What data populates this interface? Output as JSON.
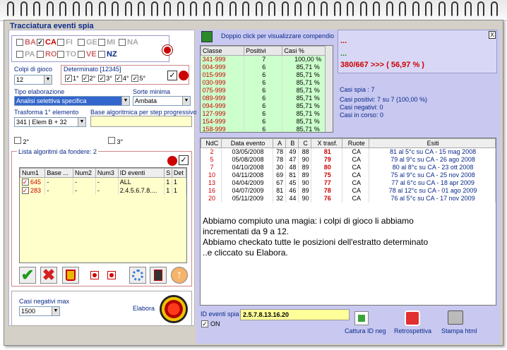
{
  "window": {
    "title": "Tracciatura eventi spia",
    "close_label": "X"
  },
  "wheels": [
    {
      "name": "BA",
      "checked": false
    },
    {
      "name": "CA",
      "checked": true
    },
    {
      "name": "FI",
      "checked": false
    },
    {
      "name": "GE",
      "checked": false
    },
    {
      "name": "MI",
      "checked": false
    },
    {
      "name": "NA",
      "checked": false
    },
    {
      "name": "PA",
      "checked": false
    },
    {
      "name": "RO",
      "checked": false
    },
    {
      "name": "TO",
      "checked": false
    },
    {
      "name": "VE",
      "checked": false
    },
    {
      "name": "NZ",
      "checked": false
    }
  ],
  "colpi": {
    "label": "Colpi di gioco",
    "value": "12"
  },
  "determinato": {
    "label": "Determinato [12345]",
    "positions": [
      "1°",
      "2°",
      "3°",
      "4°",
      "5°"
    ]
  },
  "tipo_elaborazione": {
    "label": "Tipo elaborazione",
    "value": "Analisi selettiva specifica"
  },
  "sorte_minima": {
    "label": "Sorte minima",
    "value": "Ambata"
  },
  "trasforma": {
    "label": "Trasforma 1° elemento",
    "value": "341 | Elem B + 32"
  },
  "base_alg": {
    "label": "Base algoritmica per step progressivo",
    "value": ""
  },
  "extra_checks": [
    "2°",
    "3°"
  ],
  "lista": {
    "label": "Lista algoritmi da fondere: 2",
    "columns": [
      "Num1",
      "Base ...",
      "Num2",
      "Num3",
      "ID eventi",
      "S",
      "Det"
    ],
    "rows": [
      [
        "645",
        "-",
        "-",
        "-",
        "ALL",
        "1",
        "1"
      ],
      [
        "283",
        "-",
        "-",
        "-",
        "2.4.5.6.7.8....",
        "1",
        "1"
      ]
    ]
  },
  "casi_neg_max": {
    "label": "Casi negativi max",
    "value": "1500"
  },
  "elabora_label": "Elabora",
  "compendio_hint": "Doppio click per visualizzare compendio",
  "stats": {
    "columns": [
      "Classe",
      "Positivi",
      "Casi %"
    ],
    "rows": [
      [
        "341-999",
        "7",
        "100,00 %"
      ],
      [
        "004-999",
        "6",
        "85,71 %"
      ],
      [
        "015-999",
        "6",
        "85,71 %"
      ],
      [
        "030-999",
        "6",
        "85,71 %"
      ],
      [
        "075-999",
        "6",
        "85,71 %"
      ],
      [
        "089-999",
        "6",
        "85,71 %"
      ],
      [
        "094-999",
        "6",
        "85,71 %"
      ],
      [
        "127-999",
        "6",
        "85,71 %"
      ],
      [
        "154-999",
        "6",
        "85,71 %"
      ],
      [
        "158-999",
        "6",
        "85,71 %"
      ]
    ]
  },
  "summary": {
    "dots1": "...",
    "dots2": "...",
    "ratio": "380/667 >>> ( 56,97 % )",
    "casi_spia": "Casi spia : 7",
    "casi_positivi": "Casi positivi: 7 su 7 (100,00 %)",
    "casi_negativi": "Casi negativi: 0",
    "casi_corso": "Casi in corso: 0"
  },
  "events": {
    "columns": [
      "NdC",
      "Data evento",
      "A",
      "B",
      "C",
      "X trasf.",
      "Ruote",
      "Esiti"
    ],
    "rows": [
      [
        "2",
        "03/05/2008",
        "78",
        "49",
        "88",
        "81",
        "CA",
        "81 al 5°c su CA - 15 mag 2008"
      ],
      [
        "5",
        "05/08/2008",
        "78",
        "47",
        "90",
        "79",
        "CA",
        "79 al 9°c su CA - 26 ago 2008"
      ],
      [
        "7",
        "04/10/2008",
        "30",
        "48",
        "89",
        "80",
        "CA",
        "80 al 8°c su CA - 23 ott 2008"
      ],
      [
        "10",
        "04/11/2008",
        "69",
        "81",
        "89",
        "75",
        "CA",
        "75 al 9°c su CA - 25 nov 2008"
      ],
      [
        "13",
        "04/04/2009",
        "67",
        "45",
        "90",
        "77",
        "CA",
        "77 al 6°c su CA - 18 apr 2009"
      ],
      [
        "16",
        "04/07/2009",
        "81",
        "46",
        "89",
        "78",
        "CA",
        "78 al 12°c su CA - 01 ago 2009"
      ],
      [
        "20",
        "05/11/2009",
        "32",
        "44",
        "90",
        "76",
        "CA",
        "76 al 5°c su CA - 17 nov 2009"
      ]
    ]
  },
  "annotation": {
    "line1": "Abbiamo compiuto una magia: i colpi di gioco li abbiamo",
    "line2": "incrementati da 9 a 12.",
    "line3": "Abbiamo checkato tutte le posizioni dell'estratto determinato",
    "line4": "..e cliccato su Elabora."
  },
  "id_eventi": {
    "label": "ID eventi spia",
    "value": "2.5.7.8.13.16.20",
    "on_label": "ON"
  },
  "actions": {
    "cattura": "Cattura ID neg",
    "retro": "Retrospettiva",
    "stampa": "Stampa html"
  },
  "colors": {
    "accent_red": "#cc0000",
    "green_cell": "#ccffcc",
    "yellow_field": "#ffff99",
    "lavender": "#c8c8f0"
  }
}
